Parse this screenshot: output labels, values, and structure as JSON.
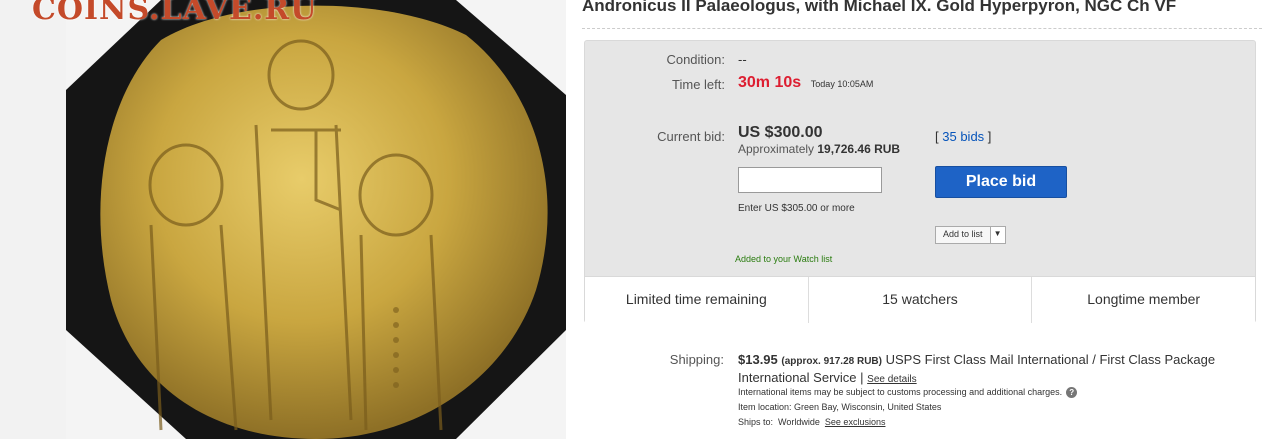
{
  "watermark": "COINS.LAVE.RU",
  "listing": {
    "title": "Andronicus II Palaeologus, with Michael IX. Gold Hyperpyron, NGC Ch VF"
  },
  "bid_box": {
    "condition_label": "Condition:",
    "condition_value": "--",
    "time_left_label": "Time left:",
    "time_left_value": "30m 10s",
    "time_left_end": "Today 10:05AM",
    "current_bid_label": "Current bid:",
    "current_bid_value": "US $300.00",
    "approx_prefix": "Approximately",
    "approx_value": "19,726.46 RUB",
    "bids_open": "[",
    "bids_link": "35 bids",
    "bids_close": "]",
    "bid_input_placeholder": "",
    "enter_hint": "Enter US $305.00 or more",
    "place_bid_label": "Place bid",
    "add_to_list_label": "Add to list",
    "watch_message": "Added to your Watch list"
  },
  "stats": [
    {
      "label": "Limited time remaining"
    },
    {
      "label": "15 watchers"
    },
    {
      "label": "Longtime member"
    }
  ],
  "shipping": {
    "label": "Shipping:",
    "price": "$13.95",
    "approx": "(approx. 917.28 RUB)",
    "service": "USPS First Class Mail International / First Class Package International Service",
    "separator": "|",
    "details_link": "See details",
    "customs_note": "International items may be subject to customs processing and additional charges.",
    "location": "Item location:  Green Bay, Wisconsin, United States",
    "ships_to_label": "Ships to:",
    "ships_to_value": "Worldwide",
    "exclusions_link": "See exclusions"
  },
  "colors": {
    "accent": "#1e63c6",
    "time_left": "#dd1e31",
    "link": "#0654ba",
    "watch_green": "#2a7c0f",
    "coin_gold": "#c9a640"
  }
}
